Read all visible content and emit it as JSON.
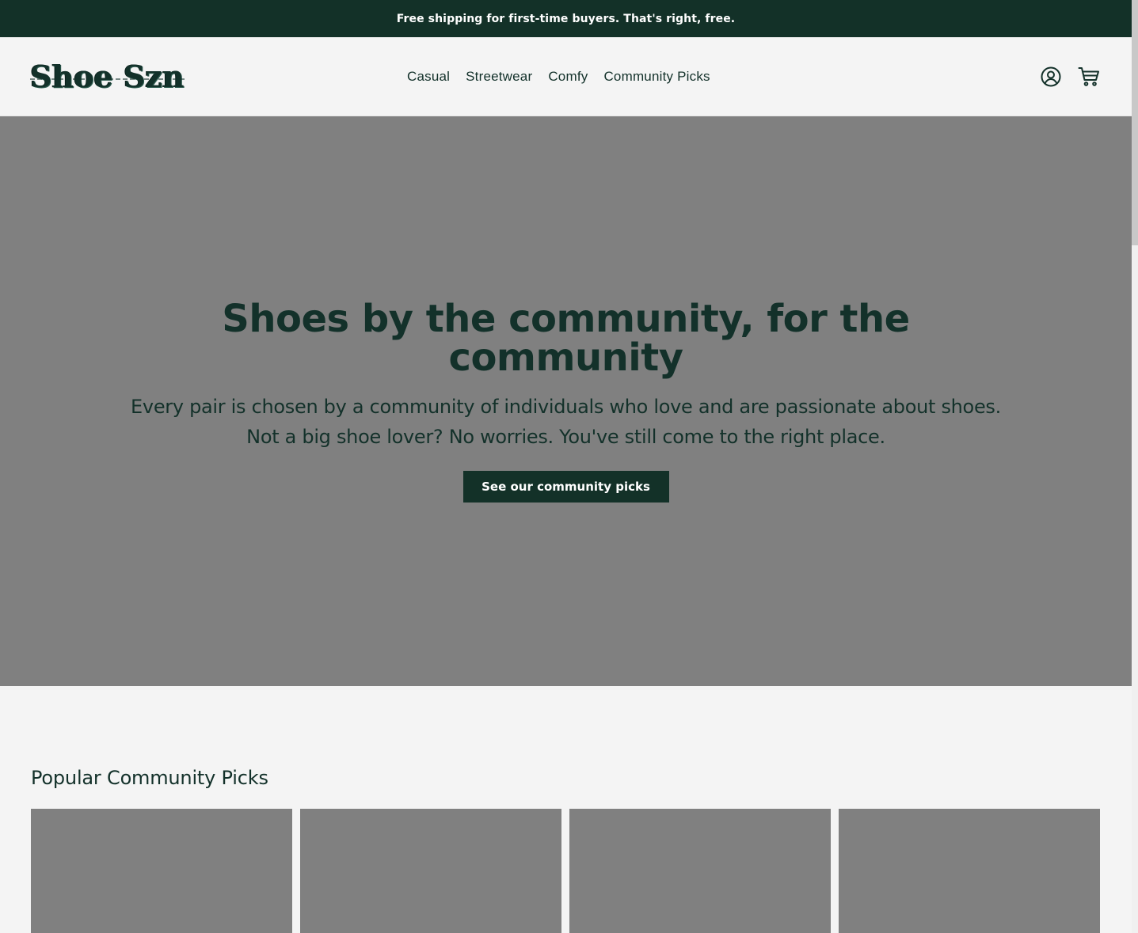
{
  "announcement": {
    "text": "Free shipping for first-time buyers. That's right, free."
  },
  "header": {
    "logo_text": "Shoe Szn",
    "nav": [
      {
        "label": "Casual"
      },
      {
        "label": "Streetwear"
      },
      {
        "label": "Comfy"
      },
      {
        "label": "Community Picks"
      }
    ],
    "icons": {
      "account": "account-icon",
      "cart": "cart-icon"
    }
  },
  "hero": {
    "title": "Shoes by the community, for the community",
    "subtitle": "Every pair is chosen by a community of individuals who love and are passionate about shoes. Not a big shoe lover? No worries. You've still come to the right place.",
    "cta_label": "See our community picks"
  },
  "popular": {
    "title": "Popular Community Picks"
  },
  "colors": {
    "brand": "#133128",
    "placeholder": "#808080",
    "background": "#f4f4f4"
  }
}
